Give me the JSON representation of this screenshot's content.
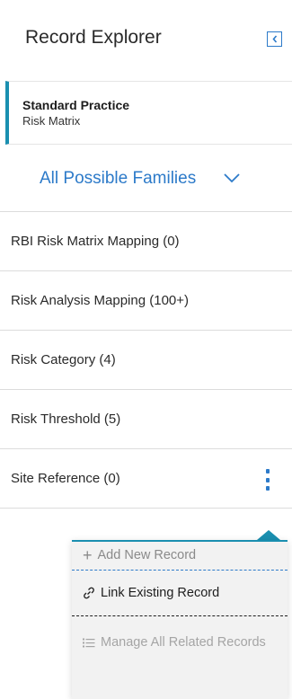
{
  "header": {
    "title": "Record Explorer",
    "collapse_icon": "chevron-left-icon"
  },
  "context": {
    "title": "Standard Practice",
    "subtitle": "Risk Matrix"
  },
  "family_select": {
    "value": "All Possible Families",
    "icon": "chevron-down-icon"
  },
  "families": [
    {
      "label": "RBI Risk Matrix Mapping (0)"
    },
    {
      "label": "Risk Analysis Mapping (100+)"
    },
    {
      "label": "Risk Category (4)"
    },
    {
      "label": "Risk Threshold (5)"
    },
    {
      "label": "Site Reference  (0)",
      "icon": "kebab-menu-icon"
    }
  ],
  "popup": {
    "add_icon": "+",
    "add_label": "Add New Record",
    "link_icon": "link-icon",
    "link_label": "Link Existing Record",
    "manage_icon": "list-icon",
    "manage_label": "Manage All Related Records"
  },
  "colors": {
    "accent": "#2c7ac9",
    "teal": "#1a8fb0",
    "disabled": "#a5a5a5"
  }
}
